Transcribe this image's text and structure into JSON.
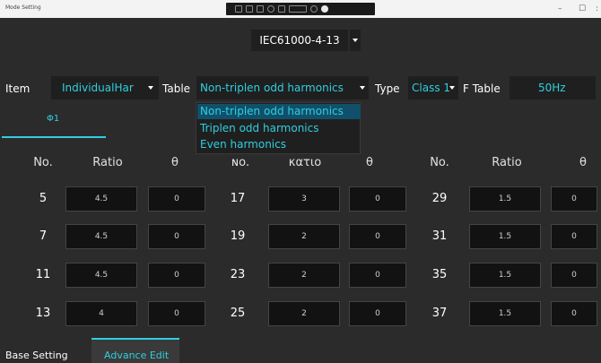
{
  "window": {
    "title": "Mode Setting",
    "minimize_glyph": "–",
    "maximize_glyph": "☐",
    "more_glyph": ":"
  },
  "standard": {
    "value": "IEC61000-4-13"
  },
  "filters": {
    "item_label": "Item",
    "item_value": "IndividualHar",
    "table_label": "Table",
    "table_value": "Non-triplen odd harmonics",
    "type_label": "Type",
    "type_value": "Class 1",
    "ftable_label": "F Table",
    "ftable_value": "50Hz"
  },
  "phase_tabs": [
    {
      "label": "Φ1"
    }
  ],
  "table_dropdown_options": [
    "Non-triplen odd harmonics",
    "Triplen odd harmonics",
    "Even harmonics"
  ],
  "columns": {
    "no": "No.",
    "ratio": "Ratio",
    "theta": "θ",
    "no_partial": "ɴᴏ.",
    "ratio_partial": "κατιο"
  },
  "groups": [
    {
      "rows": [
        {
          "no": "5",
          "ratio": "4.5",
          "theta": "0"
        },
        {
          "no": "7",
          "ratio": "4.5",
          "theta": "0"
        },
        {
          "no": "11",
          "ratio": "4.5",
          "theta": "0"
        },
        {
          "no": "13",
          "ratio": "4",
          "theta": "0"
        }
      ]
    },
    {
      "rows": [
        {
          "no": "17",
          "ratio": "3",
          "theta": "0"
        },
        {
          "no": "19",
          "ratio": "2",
          "theta": "0"
        },
        {
          "no": "23",
          "ratio": "2",
          "theta": "0"
        },
        {
          "no": "25",
          "ratio": "2",
          "theta": "0"
        }
      ]
    },
    {
      "rows": [
        {
          "no": "29",
          "ratio": "1.5",
          "theta": "0"
        },
        {
          "no": "31",
          "ratio": "1.5",
          "theta": "0"
        },
        {
          "no": "35",
          "ratio": "1.5",
          "theta": "0"
        },
        {
          "no": "37",
          "ratio": "1.5",
          "theta": "0"
        }
      ]
    }
  ],
  "bottom_tabs": {
    "base_setting": "Base Setting",
    "advance_edit": "Advance Edit"
  },
  "colors": {
    "accent": "#2fcfe0",
    "background": "#2b2b2b",
    "field_bg": "#1f1f1f",
    "cell_bg": "#121212",
    "selected_option_bg": "#11506a"
  }
}
